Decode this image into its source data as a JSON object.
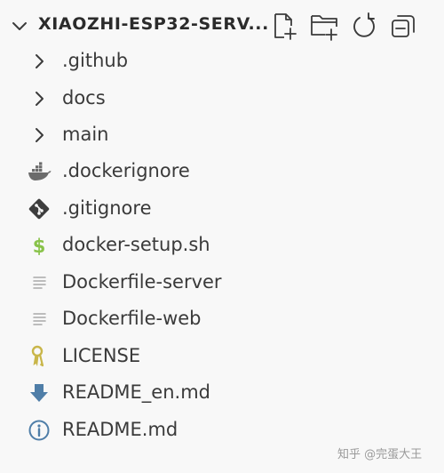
{
  "explorer": {
    "title": "XIAOZHI-ESP32-SERV...",
    "actions": [
      {
        "name": "new-file",
        "icon": "new-file-icon"
      },
      {
        "name": "new-folder",
        "icon": "new-folder-icon"
      },
      {
        "name": "refresh",
        "icon": "refresh-icon"
      },
      {
        "name": "collapse-all",
        "icon": "collapse-all-icon"
      }
    ],
    "items": [
      {
        "label": ".github",
        "type": "folder",
        "icon": "chevron-right-icon"
      },
      {
        "label": "docs",
        "type": "folder",
        "icon": "chevron-right-icon"
      },
      {
        "label": "main",
        "type": "folder",
        "icon": "chevron-right-icon"
      },
      {
        "label": ".dockerignore",
        "type": "file",
        "icon": "docker-icon"
      },
      {
        "label": ".gitignore",
        "type": "file",
        "icon": "git-icon"
      },
      {
        "label": "docker-setup.sh",
        "type": "file",
        "icon": "shell-dollar-icon"
      },
      {
        "label": "Dockerfile-server",
        "type": "file",
        "icon": "text-lines-icon"
      },
      {
        "label": "Dockerfile-web",
        "type": "file",
        "icon": "text-lines-icon"
      },
      {
        "label": "LICENSE",
        "type": "file",
        "icon": "license-key-icon"
      },
      {
        "label": "README_en.md",
        "type": "file",
        "icon": "download-arrow-icon"
      },
      {
        "label": "README.md",
        "type": "file",
        "icon": "info-icon"
      }
    ]
  },
  "colors": {
    "background": "#f8f8f8",
    "text": "#3a3a3a",
    "docker": "#6b6b6b",
    "git": "#3d3d3d",
    "shell": "#89c34a",
    "license": "#c9b64a",
    "download": "#4f7ea8",
    "info": "#4f7ea8",
    "lines": "#a9a9a9"
  },
  "watermark": "知乎 @完蛋大王"
}
